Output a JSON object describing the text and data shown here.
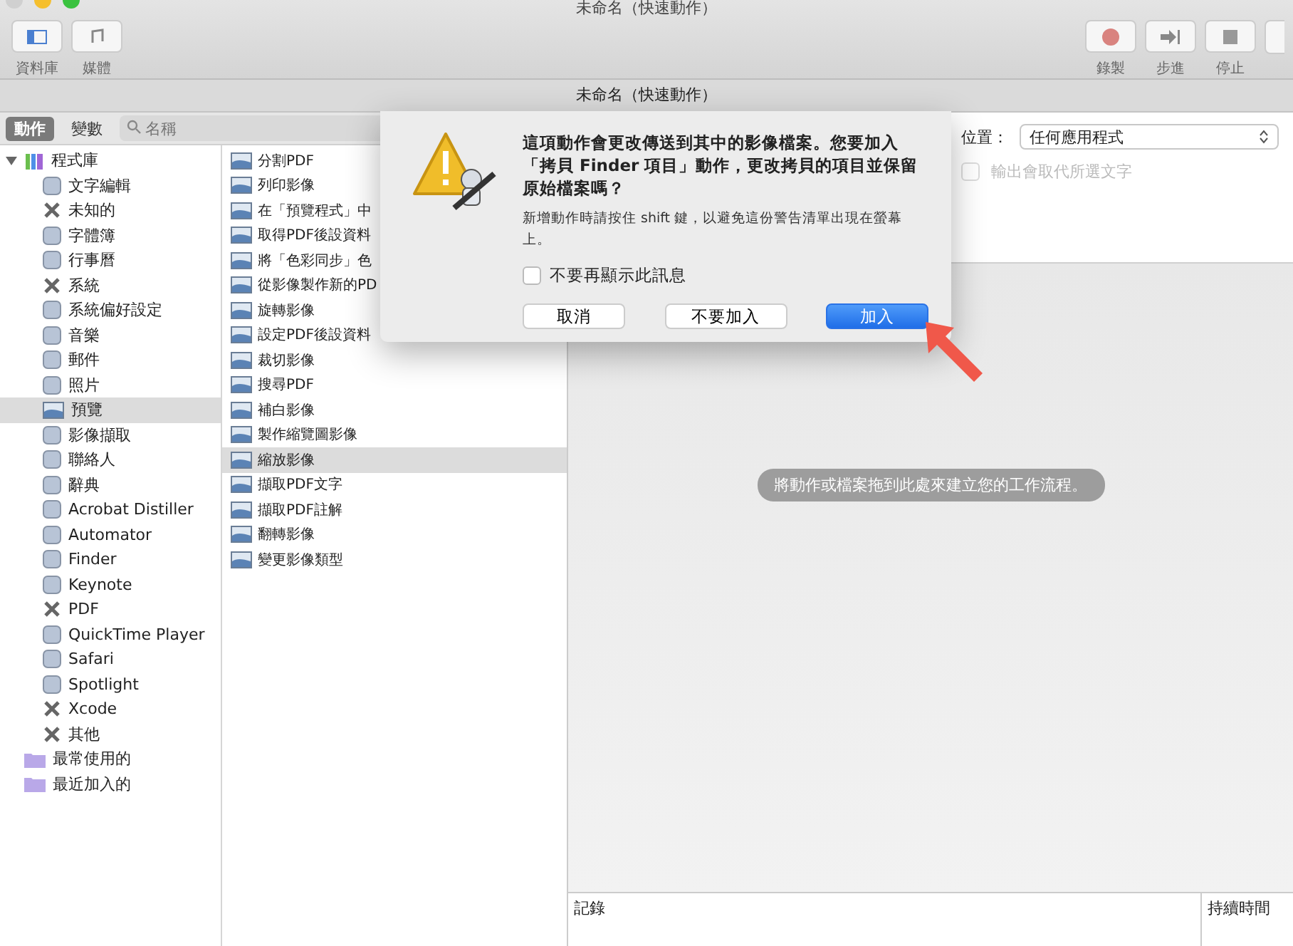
{
  "window": {
    "title": "未命名（快速動作）",
    "subtitle": "未命名（快速動作）"
  },
  "toolbar_left": [
    {
      "label": "資料庫"
    },
    {
      "label": "媒體"
    }
  ],
  "toolbar_right": [
    {
      "label": "錄製",
      "kind": "record"
    },
    {
      "label": "步進",
      "kind": "step"
    },
    {
      "label": "停止",
      "kind": "stop"
    },
    {
      "kind": "partial"
    }
  ],
  "tabs": [
    {
      "label": "動作",
      "selected": true
    },
    {
      "label": "變數",
      "selected": false
    }
  ],
  "search": {
    "placeholder": "名稱"
  },
  "library": [
    {
      "label": "程式庫",
      "kind": "library",
      "expanded": true,
      "selected": false,
      "children": [
        {
          "label": "文字編輯",
          "kind": "app",
          "selected": false
        },
        {
          "label": "未知的",
          "kind": "tools",
          "selected": false
        },
        {
          "label": "字體簿",
          "kind": "app",
          "selected": false
        },
        {
          "label": "行事曆",
          "kind": "app",
          "selected": false
        },
        {
          "label": "系統",
          "kind": "tools",
          "selected": false
        },
        {
          "label": "系統偏好設定",
          "kind": "app",
          "selected": false
        },
        {
          "label": "音樂",
          "kind": "app",
          "selected": false
        },
        {
          "label": "郵件",
          "kind": "app",
          "selected": false
        },
        {
          "label": "照片",
          "kind": "app",
          "selected": false
        },
        {
          "label": "預覽",
          "kind": "preview",
          "selected": true
        },
        {
          "label": "影像擷取",
          "kind": "app",
          "selected": false
        },
        {
          "label": "聯絡人",
          "kind": "app",
          "selected": false
        },
        {
          "label": "辭典",
          "kind": "app",
          "selected": false
        },
        {
          "label": "Acrobat Distiller",
          "kind": "app",
          "selected": false
        },
        {
          "label": "Automator",
          "kind": "app",
          "selected": false
        },
        {
          "label": "Finder",
          "kind": "app",
          "selected": false
        },
        {
          "label": "Keynote",
          "kind": "app",
          "selected": false
        },
        {
          "label": "PDF",
          "kind": "tools",
          "selected": false
        },
        {
          "label": "QuickTime Player",
          "kind": "app",
          "selected": false
        },
        {
          "label": "Safari",
          "kind": "app",
          "selected": false
        },
        {
          "label": "Spotlight",
          "kind": "app",
          "selected": false
        },
        {
          "label": "Xcode",
          "kind": "tools",
          "selected": false
        },
        {
          "label": "其他",
          "kind": "tools",
          "selected": false
        }
      ]
    },
    {
      "label": "最常使用的",
      "kind": "folder",
      "selected": false
    },
    {
      "label": "最近加入的",
      "kind": "folder",
      "selected": false
    }
  ],
  "actions": [
    {
      "label": "分割PDF",
      "selected": false
    },
    {
      "label": "列印影像",
      "selected": false
    },
    {
      "label": "在「預覽程式」中",
      "selected": false
    },
    {
      "label": "取得PDF後設資料",
      "selected": false
    },
    {
      "label": "將「色彩同步」色",
      "selected": false
    },
    {
      "label": "從影像製作新的PD",
      "selected": false
    },
    {
      "label": "旋轉影像",
      "selected": false
    },
    {
      "label": "設定PDF後設資料",
      "selected": false
    },
    {
      "label": "裁切影像",
      "selected": false
    },
    {
      "label": "搜尋PDF",
      "selected": false
    },
    {
      "label": "補白影像",
      "selected": false
    },
    {
      "label": "製作縮覽圖影像",
      "selected": false
    },
    {
      "label": "縮放影像",
      "selected": true
    },
    {
      "label": "擷取PDF文字",
      "selected": false
    },
    {
      "label": "擷取PDF註解",
      "selected": false
    },
    {
      "label": "翻轉影像",
      "selected": false
    },
    {
      "label": "變更影像類型",
      "selected": false
    }
  ],
  "config": {
    "location_label": "位置：",
    "location_value": "任何應用程式",
    "checkbox": {
      "label": "輸出會取代所選文字",
      "checked": false,
      "disabled": true
    }
  },
  "workflow": {
    "hint": "將動作或檔案拖到此處來建立您的工作流程。"
  },
  "log": {
    "columns": [
      "記錄",
      "持續時間"
    ]
  },
  "dialog": {
    "message": "這項動作會更改傳送到其中的影像檔案。您要加入「拷貝 Finder 項目」動作，更改拷貝的項目並保留原始檔案嗎？",
    "info": "新增動作時請按住 shift 鍵，以避免這份警告清單出現在螢幕上。",
    "checkbox": {
      "label": "不要再顯示此訊息",
      "checked": false
    },
    "buttons": [
      {
        "label": "取消",
        "default": false
      },
      {
        "label": "不要加入",
        "default": false
      },
      {
        "label": "加入",
        "default": true
      }
    ]
  }
}
